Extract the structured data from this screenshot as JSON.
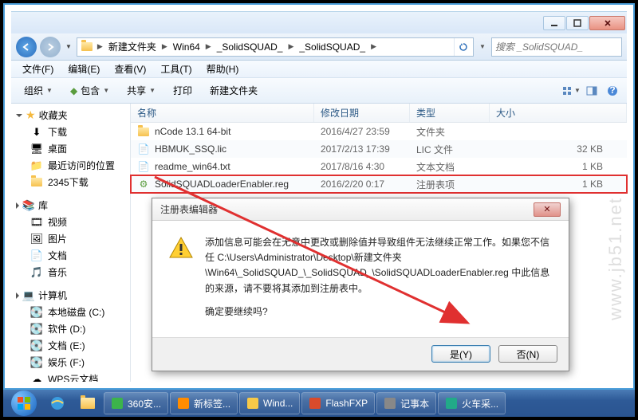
{
  "breadcrumb": {
    "segments": [
      "新建文件夹",
      "Win64",
      "_SolidSQUAD_",
      "_SolidSQUAD_"
    ]
  },
  "search": {
    "placeholder": "搜索 _SolidSQUAD_"
  },
  "menubar": {
    "file": "文件(F)",
    "edit": "编辑(E)",
    "view": "查看(V)",
    "tools": "工具(T)",
    "help": "帮助(H)"
  },
  "toolbar": {
    "organize": "组织",
    "include": "包含",
    "share": "共享",
    "print": "打印",
    "newfolder": "新建文件夹"
  },
  "columns": {
    "name": "名称",
    "date": "修改日期",
    "type": "类型",
    "size": "大小"
  },
  "sidebar": {
    "favorites": "收藏夹",
    "downloads": "下载",
    "desktop": "桌面",
    "recent": "最近访问的位置",
    "dl2345": "2345下载",
    "libraries": "库",
    "videos": "视频",
    "pictures": "图片",
    "documents": "文档",
    "music": "音乐",
    "computer": "计算机",
    "cdrive": "本地磁盘 (C:)",
    "ddrive": "软件 (D:)",
    "edrive": "文档 (E:)",
    "fdrive": "娱乐 (F:)",
    "wps": "WPS云文档"
  },
  "files": [
    {
      "name": "nCode 13.1 64-bit",
      "date": "2016/4/27 23:59",
      "type": "文件夹",
      "size": ""
    },
    {
      "name": "HBMUK_SSQ.lic",
      "date": "2017/2/13 17:39",
      "type": "LIC 文件",
      "size": "32 KB"
    },
    {
      "name": "readme_win64.txt",
      "date": "2017/8/16 4:30",
      "type": "文本文档",
      "size": "1 KB"
    },
    {
      "name": "SolidSQUADLoaderEnabler.reg",
      "date": "2016/2/20 0:17",
      "type": "注册表项",
      "size": "1 KB"
    }
  ],
  "dialog": {
    "title": "注册表编辑器",
    "line1": "添加信息可能会在无意中更改或删除值并导致组件无法继续正常工作。如果您不信任 C:\\Users\\Administrator\\Desktop\\新建文件夹\\Win64\\_SolidSQUAD_\\_SolidSQUAD_\\SolidSQUADLoaderEnabler.reg 中此信息的来源，请不要将其添加到注册表中。",
    "line2": "确定要继续吗?",
    "yes": "是(Y)",
    "no": "否(N)"
  },
  "taskbar": {
    "items": [
      "360安...",
      "新标签...",
      "Wind...",
      "FlashFXP",
      "记事本",
      "火车采..."
    ]
  },
  "watermark": "www.jb51.net"
}
